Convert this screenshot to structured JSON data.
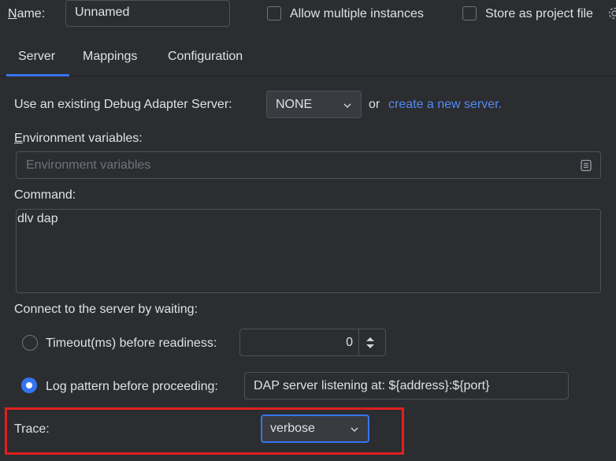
{
  "header": {
    "name_label": "Name:",
    "name_value": "Unnamed",
    "allow_multiple_label": "Allow multiple instances",
    "allow_multiple_checked": false,
    "store_project_label": "Store as project file",
    "store_project_checked": false
  },
  "tabs": [
    {
      "label": "Server",
      "active": true
    },
    {
      "label": "Mappings",
      "active": false
    },
    {
      "label": "Configuration",
      "active": false
    }
  ],
  "server": {
    "existing_label": "Use an existing Debug Adapter Server:",
    "existing_value": "NONE",
    "or_text": "or",
    "create_link": "create a new server.",
    "env_label": "Environment variables:",
    "env_placeholder": "Environment variables",
    "command_label": "Command:",
    "command_value": "dlv dap",
    "connect_label": "Connect to the server by waiting:",
    "timeout_label": "Timeout(ms) before readiness:",
    "timeout_value": "0",
    "timeout_selected": false,
    "log_pattern_label": "Log pattern before proceeding:",
    "log_pattern_value": "DAP server listening at: ${address}:${port}",
    "log_pattern_selected": true,
    "trace_label": "Trace:",
    "trace_value": "verbose"
  },
  "colors": {
    "background": "#2b2d30",
    "accent": "#3574f0",
    "link": "#548af7",
    "highlight_box": "#e02020"
  },
  "icons": {
    "settings": "gear-icon",
    "env_browse": "document-icon",
    "combo_arrow": "chevron-down-icon",
    "spinner": "spinner-arrows-icon"
  }
}
